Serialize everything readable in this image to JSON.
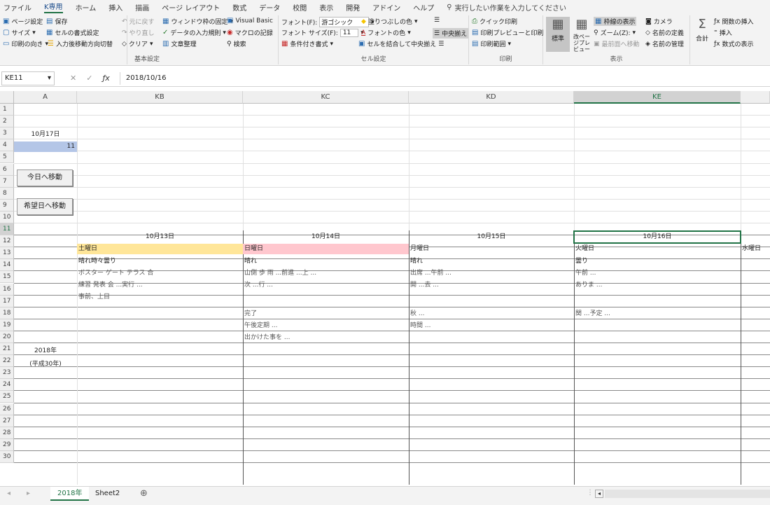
{
  "menu": {
    "tabs": [
      "ファイル",
      "K専用",
      "ホーム",
      "挿入",
      "描画",
      "ページ レイアウト",
      "数式",
      "データ",
      "校閲",
      "表示",
      "開発",
      "アドイン",
      "ヘルプ"
    ],
    "active": "K専用",
    "tell_me": "実行したい作業を入力してください"
  },
  "ribbon": {
    "basic": {
      "title": "基本設定",
      "page_setup": "ページ設定",
      "save": "保存",
      "size": "サイズ",
      "cell_format": "セルの書式設定",
      "orientation": "印刷の向き",
      "input_direction": "入力後移動方向切替",
      "undo": "元に戻す",
      "redo": "やり直し",
      "clear": "クリア",
      "freeze": "ウィンドウ枠の固定",
      "validation": "データの入力規則",
      "doc_organize": "文章整理",
      "vba": "Visual Basic",
      "macro_record": "マクロの記録",
      "search": "検索"
    },
    "cell": {
      "title": "セル設定",
      "font": "フォント(F):",
      "font_value": "游ゴシック",
      "font_size": "フォント サイズ(F):",
      "font_size_value": "11",
      "fill_color": "塗りつぶしの色",
      "font_color": "フォントの色",
      "cond_format": "条件付き書式",
      "merge_center": "セルを結合して中央揃え",
      "center": "中央揃え"
    },
    "print": {
      "title": "印刷",
      "quick_print": "クイック印刷",
      "print_preview": "印刷プレビューと印刷",
      "print_area": "印刷範囲"
    },
    "view": {
      "title": "表示",
      "normal": "標準",
      "page_preview": "改ページプレビュー",
      "gridlines": "枠線の表示",
      "zoom": "ズーム(Z):",
      "prev_screen": "最前面へ移動",
      "camera": "カメラ",
      "name_define": "名前の定義",
      "name_manager": "名前の管理"
    },
    "formula": {
      "sum": "合計",
      "insert_func": "関数の挿入",
      "insert": "挿入",
      "show_formula": "数式の表示"
    }
  },
  "formula_bar": {
    "name_box": "KE11",
    "value": "2018/10/16"
  },
  "columns": [
    {
      "id": "A",
      "label": "A"
    },
    {
      "id": "KB",
      "label": "KB"
    },
    {
      "id": "KC",
      "label": "KC"
    },
    {
      "id": "KD",
      "label": "KD"
    },
    {
      "id": "KE",
      "label": "KE"
    }
  ],
  "rows": [
    "1",
    "2",
    "3",
    "4",
    "5",
    "6",
    "7",
    "8",
    "9",
    "10",
    "11",
    "12",
    "13",
    "14",
    "15",
    "16",
    "17",
    "18",
    "19",
    "20",
    "21",
    "22",
    "23",
    "24",
    "25",
    "26",
    "27",
    "28",
    "29",
    "30"
  ],
  "cells": {
    "a3": "10月17日",
    "a4": "11",
    "a20": "2018年",
    "a21": "(平成30年)",
    "today_button": "今日へ移動",
    "wish_button": "希望日へ移動",
    "kb11": "10月13日",
    "kc11": "10月14日",
    "kd11": "10月15日",
    "ke11": "10月16日",
    "kb12": "土曜日",
    "kc12": "日曜日",
    "kd12": "月曜日",
    "ke12": "火曜日",
    "kf12": "水曜日",
    "kb13": "晴れ時々曇り",
    "kc13": "晴れ",
    "kd13": "晴れ",
    "ke13": "曇り",
    "kb14": "ボスター ゲート テラス 合",
    "kb15": "練習 発表 会 ...実行 ...",
    "kb16": "事前、上目",
    "kc14": "山側 歩 雨 ...前進 ...上 ...",
    "kc15": "次 ...行 ...",
    "kc17": "完了",
    "kc18": "午後定期 ...",
    "kc19": "出かけた事を ...",
    "kd14": "出席 ...午前 ...",
    "kd15": "開 ...去 ...",
    "kd17": "秋 ...",
    "kd18": "時間 ...",
    "ke14": "午前 ...",
    "ke15": "ありま ...",
    "ke17": "関 ...予定 ..."
  },
  "sheet_tabs": [
    "2018年",
    "Sheet2"
  ],
  "colors": {
    "saturday": "#ffe699",
    "sunday": "#ffc7ce",
    "selected_a4": "#b4c6e7",
    "accent": "#217346"
  }
}
